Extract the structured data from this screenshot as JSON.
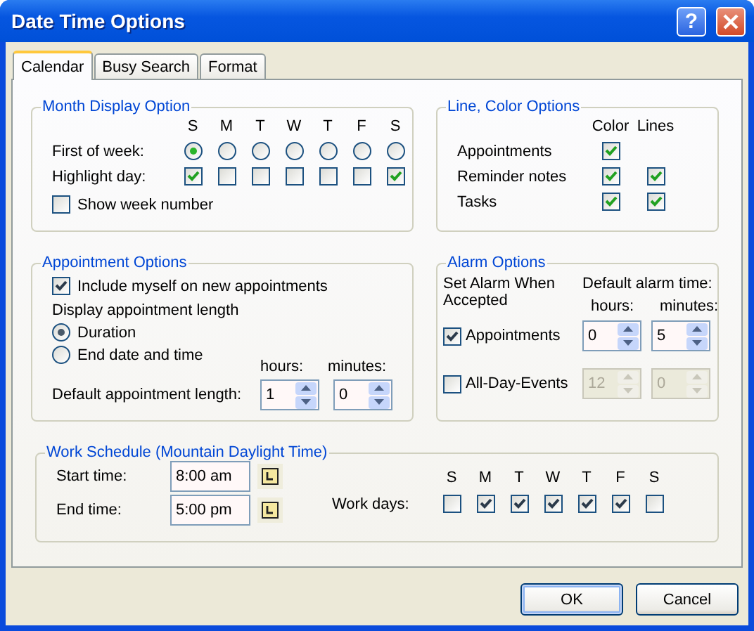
{
  "window": {
    "title": "Date Time Options",
    "help_button": "?"
  },
  "tabs": [
    {
      "label": "Calendar",
      "selected": true
    },
    {
      "label": "Busy Search",
      "selected": false
    },
    {
      "label": "Format",
      "selected": false
    }
  ],
  "month_display": {
    "title": "Month Display Option",
    "days": [
      "S",
      "M",
      "T",
      "W",
      "T",
      "F",
      "S"
    ],
    "first_of_week": {
      "label": "First of week:",
      "options": [
        {
          "selected": true
        },
        {
          "selected": false
        },
        {
          "selected": false
        },
        {
          "selected": false
        },
        {
          "selected": false
        },
        {
          "selected": false
        },
        {
          "selected": false
        }
      ]
    },
    "highlight_day": {
      "label": "Highlight day:",
      "days": [
        {
          "checked": true
        },
        {
          "checked": false
        },
        {
          "checked": false
        },
        {
          "checked": false
        },
        {
          "checked": false
        },
        {
          "checked": false
        },
        {
          "checked": true
        }
      ]
    },
    "show_week_number": {
      "label": "Show week number",
      "checked": false
    }
  },
  "line_color": {
    "title": "Line, Color Options",
    "columns": [
      "Color",
      "Lines"
    ],
    "rows": [
      {
        "label": "Appointments",
        "color": {
          "checked": true
        }
      },
      {
        "label": "Reminder notes",
        "color": {
          "checked": true
        },
        "lines": {
          "checked": true
        }
      },
      {
        "label": "Tasks",
        "color": {
          "checked": true
        },
        "lines": {
          "checked": true
        }
      }
    ]
  },
  "appointment": {
    "title": "Appointment Options",
    "include_myself": {
      "label": "Include myself on new appointments",
      "checked": true
    },
    "display_length_label": "Display appointment length",
    "length_modes": [
      {
        "label": "Duration",
        "selected": true
      },
      {
        "label": "End date and time",
        "selected": false
      }
    ],
    "default_length": {
      "label": "Default appointment length:",
      "hours_label": "hours:",
      "minutes_label": "minutes:",
      "hours": "1",
      "minutes": "0"
    }
  },
  "alarm": {
    "title": "Alarm Options",
    "set_label": "Set Alarm When Accepted",
    "default_label": "Default alarm time:",
    "hours_label": "hours:",
    "minutes_label": "minutes:",
    "rows": [
      {
        "label": "Appointments",
        "checked": true,
        "disabled": false,
        "hours": "0",
        "minutes": "5"
      },
      {
        "label": "All-Day-Events",
        "checked": false,
        "disabled": true,
        "hours": "12",
        "minutes": "0"
      }
    ]
  },
  "work_schedule": {
    "title": "Work Schedule (Mountain Daylight Time)",
    "start": {
      "label": "Start time:",
      "value": "8:00 am"
    },
    "end": {
      "label": "End time:",
      "value": "5:00 pm"
    },
    "days": [
      "S",
      "M",
      "T",
      "W",
      "T",
      "F",
      "S"
    ],
    "work_days_label": "Work days:",
    "work_days": [
      {
        "checked": false
      },
      {
        "checked": true
      },
      {
        "checked": true
      },
      {
        "checked": true
      },
      {
        "checked": true
      },
      {
        "checked": true
      },
      {
        "checked": false
      }
    ]
  },
  "buttons": [
    {
      "label": "OK",
      "kind": "default"
    },
    {
      "label": "Cancel",
      "kind": "normal"
    }
  ]
}
